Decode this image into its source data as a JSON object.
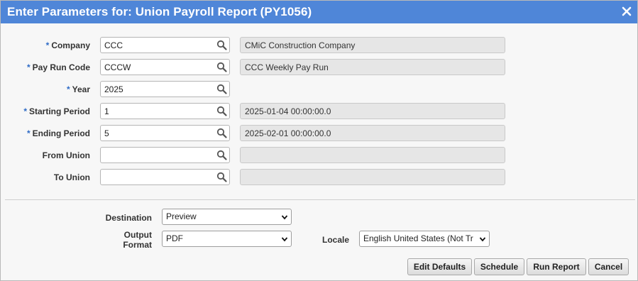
{
  "dialog": {
    "title": "Enter Parameters for: Union Payroll Report (PY1056)",
    "close_icon": "close-icon"
  },
  "fields": [
    {
      "key": "company",
      "required": true,
      "label": "Company",
      "value": "CCC",
      "description": "CMiC Construction Company"
    },
    {
      "key": "pay-run-code",
      "required": true,
      "label": "Pay Run Code",
      "value": "CCCW",
      "description": "CCC Weekly Pay Run"
    },
    {
      "key": "year",
      "required": true,
      "label": "Year",
      "value": "2025",
      "description": null
    },
    {
      "key": "starting-period",
      "required": true,
      "label": "Starting Period",
      "value": "1",
      "description": "2025-01-04 00:00:00.0"
    },
    {
      "key": "ending-period",
      "required": true,
      "label": "Ending Period",
      "value": "5",
      "description": "2025-02-01 00:00:00.0"
    },
    {
      "key": "from-union",
      "required": false,
      "label": "From Union",
      "value": "",
      "description": ""
    },
    {
      "key": "to-union",
      "required": false,
      "label": "To Union",
      "value": "",
      "description": ""
    }
  ],
  "required_marker": "*",
  "output": {
    "destination_label": "Destination",
    "destination_value": "Preview",
    "format_label_line1": "Output",
    "format_label_line2": "Format",
    "format_value": "PDF",
    "locale_label": "Locale",
    "locale_value": "English United States (Not Tr"
  },
  "buttons": {
    "edit_defaults": "Edit Defaults",
    "schedule": "Schedule",
    "run_report": "Run Report",
    "cancel": "Cancel"
  }
}
